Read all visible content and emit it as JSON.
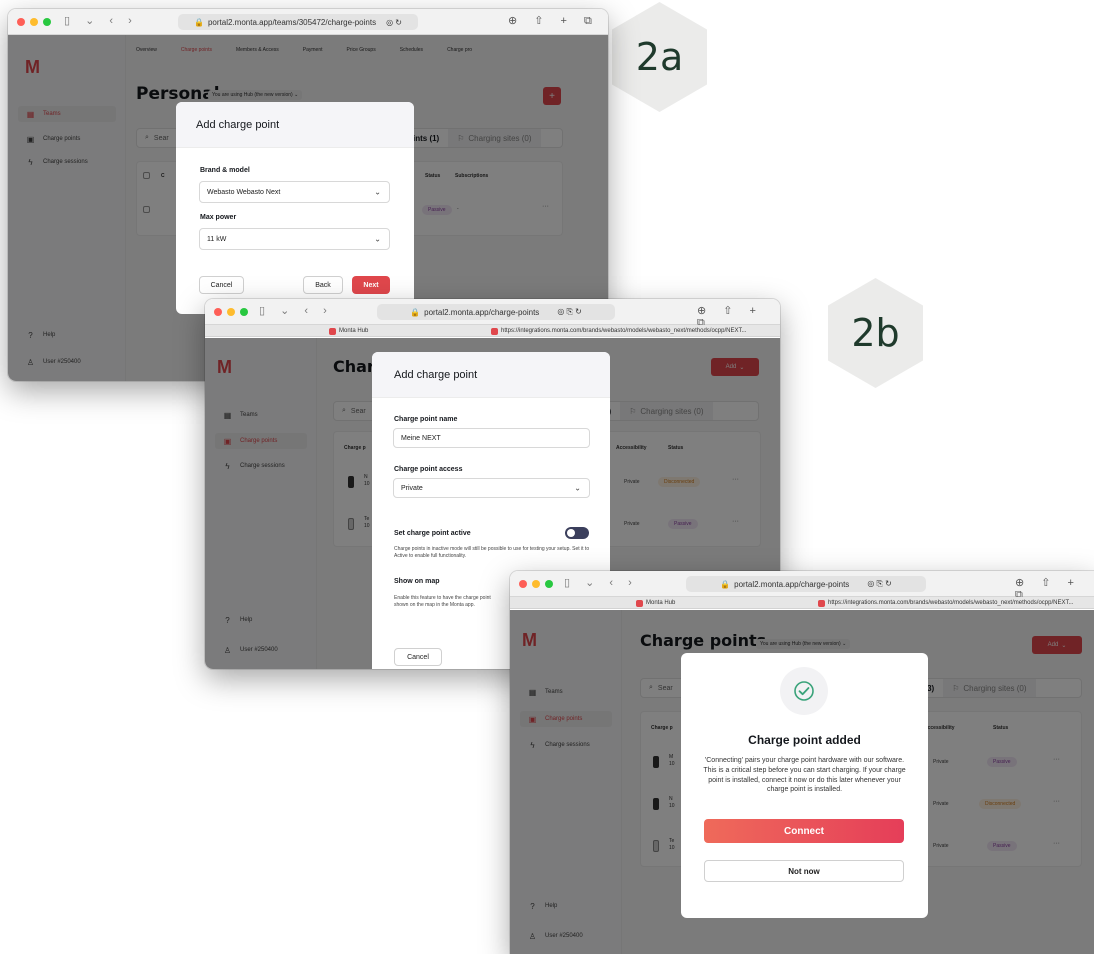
{
  "badges": {
    "step_a": "2a",
    "step_b": "2b"
  },
  "colors": {
    "brand": "#e0474c",
    "sidebar": "#f7f7f8",
    "overlay": "#000000",
    "passive": "#8a3fa1",
    "disconnected": "#d07a17",
    "success": "#3aa37a"
  },
  "window_a": {
    "url": "portal2.monta.app/teams/305472/charge-points",
    "top_tabs": [
      "Overview",
      "Charge points",
      "Members & Access",
      "Payment",
      "Price Groups",
      "Schedules",
      "Charge pro"
    ],
    "logo": "M",
    "sidebar": {
      "items": [
        "Teams",
        "Charge points",
        "Charge sessions"
      ],
      "help": "Help",
      "user": "User #250400"
    },
    "page_title": "Personal",
    "hub_pill": "You are using Hub (the new version)",
    "add_icon": "+",
    "search_placeholder": "Sear",
    "seg_count": "ints (1)",
    "seg_sites": "Charging sites (0)",
    "table_headers": {
      "col": "C",
      "status": "Status",
      "subs": "Subscriptions"
    },
    "row": {
      "status": "Passive",
      "dash": "-",
      "more": "···"
    },
    "modal": {
      "title": "Add charge point",
      "brand_label": "Brand & model",
      "brand_value": "Webasto Webasto Next",
      "power_label": "Max power",
      "power_value": "11 kW",
      "cancel": "Cancel",
      "back": "Back",
      "next": "Next"
    }
  },
  "window_b": {
    "url": "portal2.monta.app/charge-points",
    "tab1": "Monta Hub",
    "tab2": "https://integrations.monta.com/brands/webasto/models/webasto_next/methods/ocpp/NEXT...",
    "logo": "M",
    "sidebar": {
      "items": [
        "Teams",
        "Charge points",
        "Charge sessions"
      ],
      "help": "Help",
      "user": "User #250400"
    },
    "page_title": "Charg",
    "add_label": "Add",
    "search_placeholder": "Sear",
    "seg_count": "ints (2)",
    "seg_sites": "Charging sites (0)",
    "table_headers": {
      "charge": "Charge p",
      "access": "Accessibility",
      "status": "Status"
    },
    "rows": [
      {
        "n": "N",
        "sub": "10",
        "access": "Private",
        "status": "Disconnected"
      },
      {
        "n": "Te",
        "sub": "10",
        "access": "Private",
        "status": "Passive"
      }
    ],
    "modal": {
      "title": "Add charge point",
      "name_label": "Charge point name",
      "name_value": "Meine NEXT",
      "access_label": "Charge point access",
      "access_value": "Private",
      "active_label": "Set charge point active",
      "active_help": "Charge points in inactive mode will still be possible to use for testing your setup. Set it to Active to enable full functionality.",
      "map_label": "Show on map",
      "map_help": "Enable this feature to have the charge point shown on the map in the Monta app.",
      "cancel": "Cancel"
    }
  },
  "window_c": {
    "url": "portal2.monta.app/charge-points",
    "tab1": "Monta Hub",
    "tab2": "https://integrations.monta.com/brands/webasto/models/webasto_next/methods/ocpp/NEXT...",
    "logo": "M",
    "sidebar": {
      "items": [
        "Teams",
        "Charge points",
        "Charge sessions"
      ],
      "help": "Help",
      "user": "User #250400"
    },
    "page_title": "Charge points",
    "hub_pill": "You are using Hub (the new version)",
    "add_label": "Add",
    "search_placeholder": "Sear",
    "seg_count": "ints (3)",
    "seg_sites": "Charging sites (0)",
    "table_headers": {
      "charge": "Charge p",
      "access": "Accessibility",
      "status": "Status"
    },
    "rows": [
      {
        "n": "M",
        "sub": "10",
        "access": "Private",
        "status": "Passive"
      },
      {
        "n": "N",
        "sub": "10",
        "access": "Private",
        "status": "Disconnected"
      },
      {
        "n": "Te",
        "sub": "10",
        "access": "Private",
        "status": "Passive"
      }
    ],
    "modal": {
      "title": "Charge point added",
      "body": "'Connecting' pairs your charge point hardware with our software. This is a critical step before you can start charging. If your charge point is installed, connect it now or do this later whenever your charge point is installed.",
      "connect": "Connect",
      "not_now": "Not now"
    }
  }
}
